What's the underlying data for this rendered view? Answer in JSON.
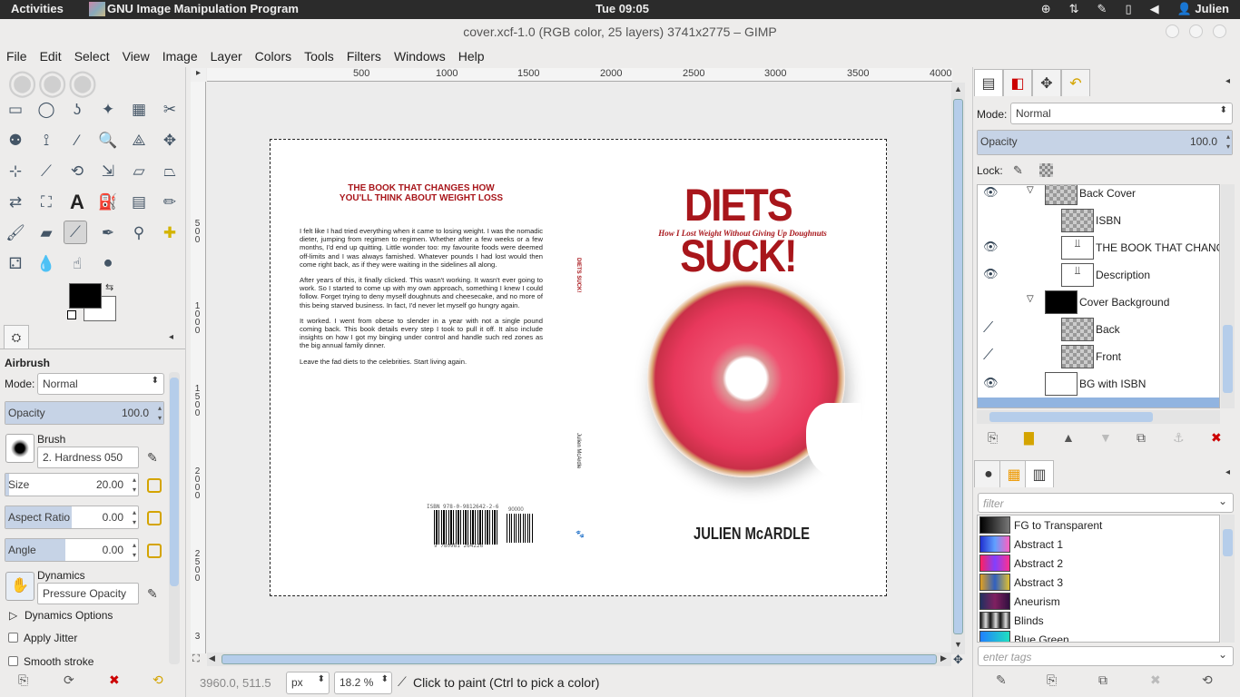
{
  "topbar": {
    "activities": "Activities",
    "app_name": "GNU Image Manipulation Program",
    "clock": "Tue 09:05",
    "user": "Julien"
  },
  "window": {
    "title": "cover.xcf-1.0 (RGB color, 25 layers) 3741x2775 – GIMP"
  },
  "menu": [
    "File",
    "Edit",
    "Select",
    "View",
    "Image",
    "Layer",
    "Colors",
    "Tools",
    "Filters",
    "Windows",
    "Help"
  ],
  "tool_options": {
    "tool_name": "Airbrush",
    "mode_label": "Mode:",
    "mode_value": "Normal",
    "opacity_label": "Opacity",
    "opacity_value": "100.0",
    "brush_label": "Brush",
    "brush_value": "2. Hardness 050",
    "size_label": "Size",
    "size_value": "20.00",
    "aspect_label": "Aspect Ratio",
    "aspect_value": "0.00",
    "angle_label": "Angle",
    "angle_value": "0.00",
    "dynamics_label": "Dynamics",
    "dynamics_value": "Pressure Opacity",
    "dynamics_options": "Dynamics Options",
    "apply_jitter": "Apply Jitter",
    "smooth_stroke": "Smooth stroke"
  },
  "rulers": {
    "h": [
      "500",
      "1000",
      "1500",
      "2000",
      "2500",
      "3000",
      "3500",
      "4000"
    ],
    "v": [
      "5\n0\n0",
      "1\n0\n0\n0",
      "1\n5\n0\n0",
      "2\n0\n0\n0",
      "2\n5\n0\n0",
      "3"
    ]
  },
  "cover": {
    "back_headline": "THE BOOK THAT CHANGES HOW\nYOU'LL THINK ABOUT WEIGHT LOSS",
    "back_p1": "I felt like I had tried everything when it came to losing weight. I was the nomadic dieter, jumping from regimen to regimen. Whether after a few weeks or a few months, I'd end up quitting. Little wonder too: my favourite foods were deemed off-limits and I was always famished. Whatever pounds I had lost would then come right back, as if they were waiting in the sidelines all along.",
    "back_p2": "After years of this, it finally clicked. This wasn't working. It wasn't ever going to work. So I started to come up with my own approach, something I knew I could follow. Forget trying to deny myself doughnuts and cheesecake, and no more of this being starved business. In fact, I'd never let myself go hungry again.",
    "back_p3": "It worked. I went from obese to slender in a year with not a single pound coming back. This book details every step I took to pull it off. It also include insights on how I got my binging under control and handle such red zones as the big annual family dinner.",
    "back_p4": "Leave the fad diets to the celebrities. Start living again.",
    "isbn_text": "ISBN 978-0-9812642-2-6",
    "isbn_price": "90000",
    "isbn_digits": "9 780981 264226",
    "spine_title": "DIETS SUCK!",
    "spine_author": "Julien McArdle",
    "front_title": "DIETS SUCK!",
    "front_subtitle": "How I Lost Weight Without Giving Up Doughnuts",
    "front_author": "JULIEN McARDLE"
  },
  "status": {
    "coords": "3960.0, 511.5",
    "unit": "px",
    "zoom": "18.2 %",
    "message": "Click to paint (Ctrl to pick a color)"
  },
  "layers_panel": {
    "mode_label": "Mode:",
    "mode_value": "Normal",
    "opacity_label": "Opacity",
    "opacity_value": "100.0",
    "lock_label": "Lock:",
    "layers": [
      {
        "name": "Back Cover",
        "visible": true,
        "group": true
      },
      {
        "name": "ISBN",
        "visible": false,
        "group": false
      },
      {
        "name": "THE BOOK THAT CHANGES",
        "visible": true,
        "group": false
      },
      {
        "name": "Description",
        "visible": true,
        "group": false
      },
      {
        "name": "Cover Background",
        "visible": false,
        "group": true
      },
      {
        "name": "Back",
        "visible": false,
        "group": false
      },
      {
        "name": "Front",
        "visible": false,
        "group": false
      },
      {
        "name": "BG with ISBN",
        "visible": true,
        "group": false
      }
    ]
  },
  "gradients_panel": {
    "filter_placeholder": "filter",
    "tags_placeholder": "enter tags",
    "gradients": [
      "FG to Transparent",
      "Abstract 1",
      "Abstract 2",
      "Abstract 3",
      "Aneurism",
      "Blinds",
      "Blue Green"
    ]
  },
  "colors": {
    "title_red": "#a8161b",
    "accent_blue": "#c6d3e6",
    "fg": "#000000",
    "bg": "#ffffff"
  }
}
